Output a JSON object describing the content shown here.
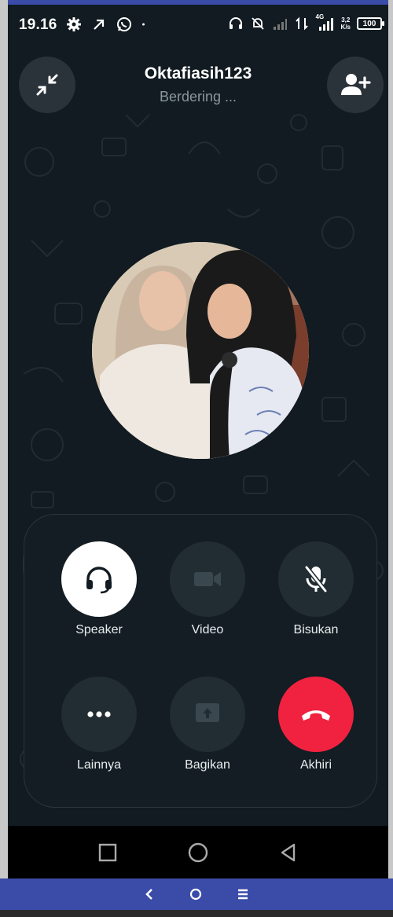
{
  "status_bar": {
    "time": "19.16",
    "left_icons": [
      "gear-icon",
      "arrow-icon",
      "whatsapp-icon",
      "dot-icon"
    ],
    "right_icons": [
      "headset-icon",
      "muted-bell-icon",
      "signal-icon",
      "data-arrows-icon",
      "signal-4g-icon"
    ],
    "net_speed_value": "3,2",
    "net_speed_unit": "K/s",
    "network_type": "4G",
    "battery": "100"
  },
  "call": {
    "caller_name": "Oktafiasih123",
    "status": "Berdering ..."
  },
  "controls": {
    "speaker": {
      "label": "Speaker",
      "icon": "headphones-icon"
    },
    "video": {
      "label": "Video",
      "icon": "video-camera-icon"
    },
    "mute": {
      "label": "Bisukan",
      "icon": "mic-off-icon"
    },
    "more": {
      "label": "Lainnya",
      "icon": "more-dots-icon"
    },
    "share": {
      "label": "Bagikan",
      "icon": "share-screen-icon"
    },
    "end": {
      "label": "Akhiri",
      "icon": "end-call-icon"
    }
  },
  "colors": {
    "background": "#111b21",
    "button": "#222d33",
    "end_call": "#f0223f",
    "host_bar": "#3a4ba8"
  }
}
